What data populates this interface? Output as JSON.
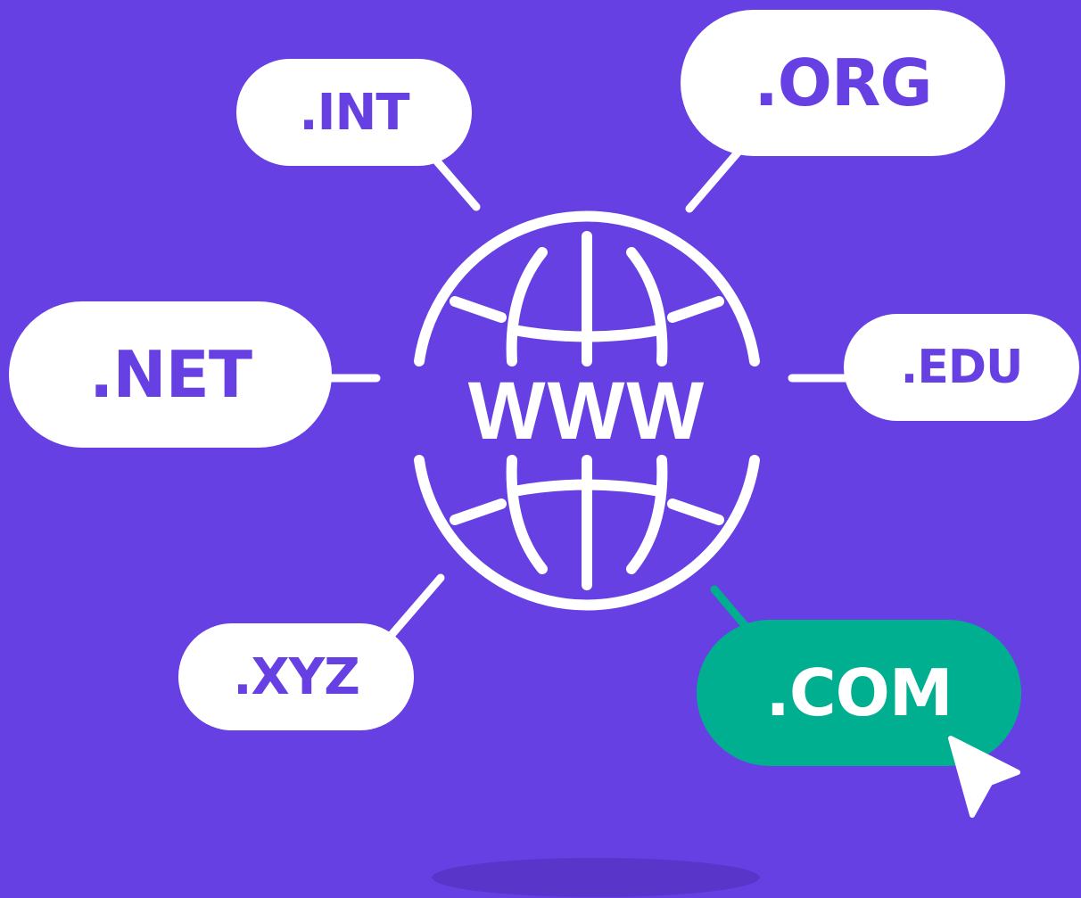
{
  "colors": {
    "background": "#6740e4",
    "pill_white": "#ffffff",
    "pill_highlight": "#00af90",
    "shadow": "#5a35c9"
  },
  "center": {
    "label": "WWW",
    "icon": "globe-icon"
  },
  "domains": {
    "int": ".INT",
    "org": ".ORG",
    "net": ".NET",
    "edu": ".EDU",
    "xyz": ".XYZ",
    "com": ".COM"
  },
  "selected_domain": ".COM",
  "cursor": "cursor-arrow-icon"
}
